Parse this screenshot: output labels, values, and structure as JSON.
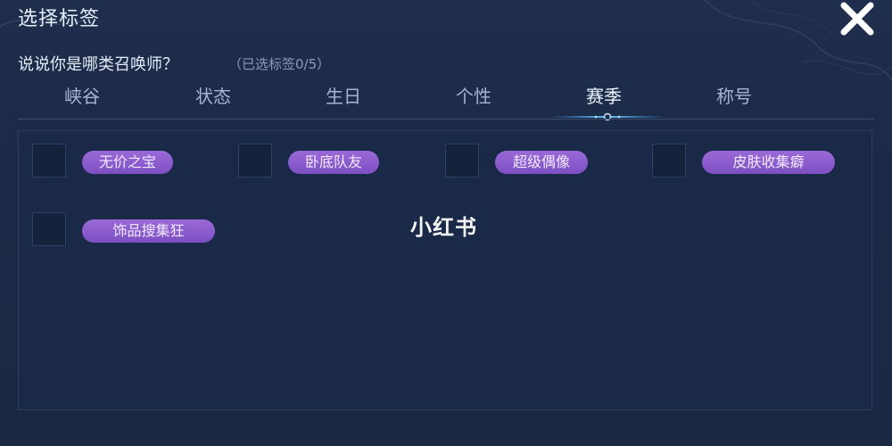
{
  "header": {
    "title": "选择标签",
    "close_icon": "close-x-icon"
  },
  "prompt": {
    "question": "说说你是哪类召唤师？",
    "selected_count": "（已选标签0/5）"
  },
  "tabs": [
    {
      "label": "峡谷",
      "active": false
    },
    {
      "label": "状态",
      "active": false
    },
    {
      "label": "生日",
      "active": false
    },
    {
      "label": "个性",
      "active": false
    },
    {
      "label": "赛季",
      "active": true
    },
    {
      "label": "称号",
      "active": false
    }
  ],
  "tags": [
    {
      "label": "无价之宝",
      "checked": false
    },
    {
      "label": "卧底队友",
      "checked": false
    },
    {
      "label": "超级偶像",
      "checked": false
    },
    {
      "label": "皮肤收集癖",
      "checked": false
    },
    {
      "label": "饰品搜集狂",
      "checked": false
    }
  ],
  "watermark": "小红书",
  "colors": {
    "background": "#1c2a45",
    "panel": "#1a2948",
    "tag_pill": "#8a5ccc",
    "active_tab_glow": "#3fa4ff"
  }
}
